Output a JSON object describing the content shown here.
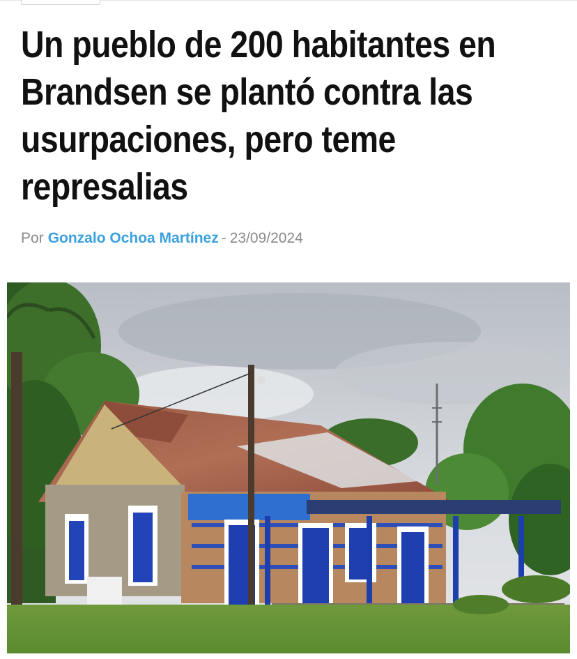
{
  "article": {
    "headline": "Un pueblo de 200 habitantes en Brandsen se plantó contra las usurpaciones, pero teme represalias",
    "byline_prefix": "Por",
    "author": "Gonzalo Ochoa Martínez",
    "separator": "-",
    "date": "23/09/2024"
  },
  "photo": {
    "description_icon": "photo-train-station"
  },
  "colors": {
    "author_link": "#3aa0e0",
    "headline": "#111111",
    "meta": "#8a8a8a",
    "door_blue": "#1f3fb0"
  }
}
